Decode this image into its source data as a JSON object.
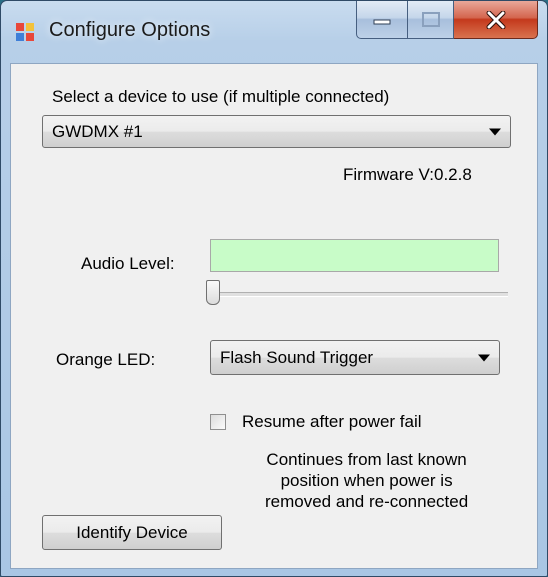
{
  "window": {
    "title": "Configure Options"
  },
  "device": {
    "prompt": "Select a device to use (if multiple connected)",
    "selected": "GWDMX #1",
    "firmware": "Firmware V:0.2.8"
  },
  "audio": {
    "label": "Audio Level:",
    "level": 0.0,
    "slider_value": 0.0
  },
  "led": {
    "label": "Orange LED:",
    "selected": "Flash Sound Trigger"
  },
  "resume": {
    "label": "Resume after power fail",
    "checked": false,
    "description_lines": [
      "Continues from last known",
      "position when power is",
      "removed and re-connected"
    ]
  },
  "actions": {
    "identify_label": "Identify Device"
  },
  "colors": {
    "level_fill": "#c8fcc8"
  }
}
